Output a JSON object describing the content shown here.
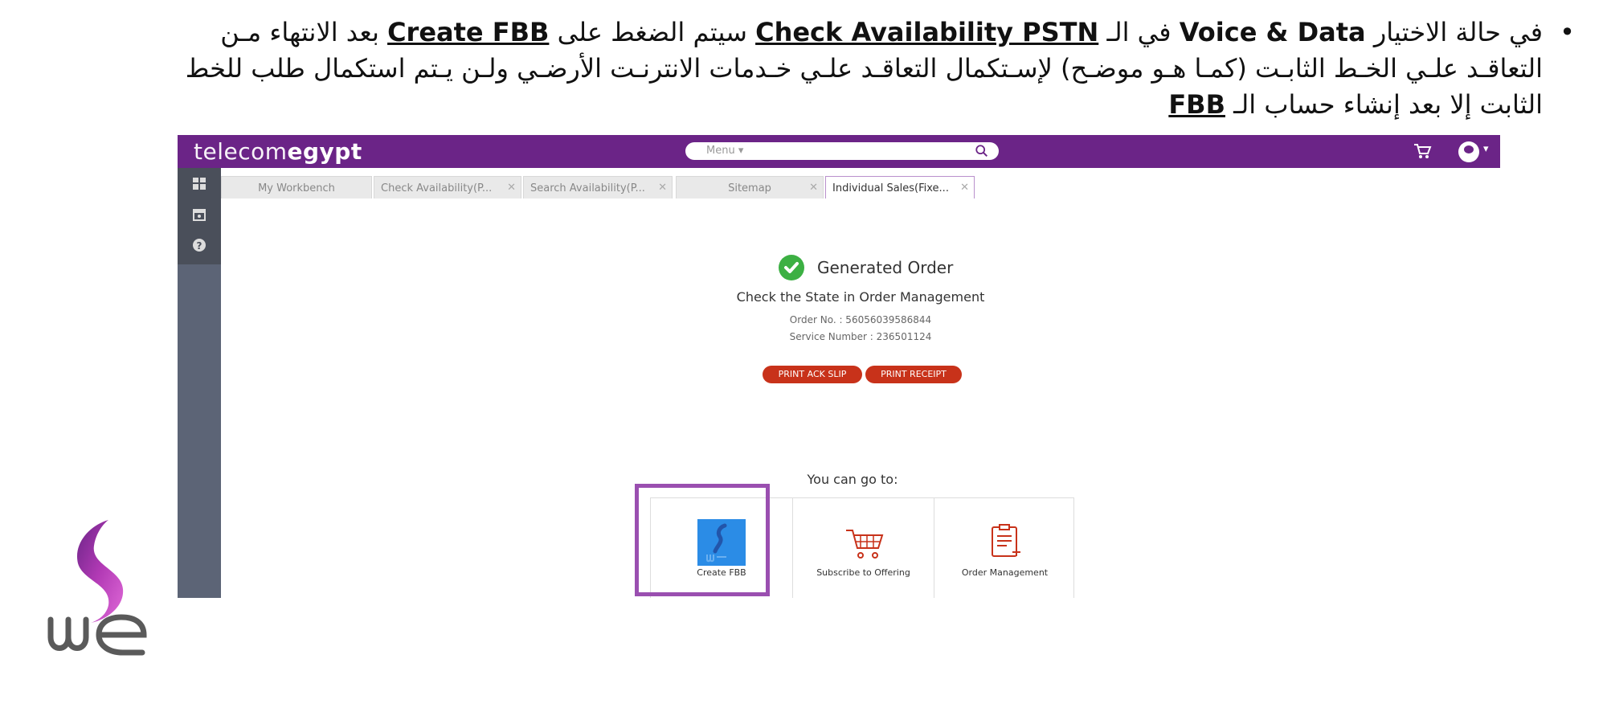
{
  "instruction": {
    "t1": "في حالة الاختيار ",
    "voice_data": "Voice & Data",
    "t2": " في الـ ",
    "check_avail": "Check Availability PSTN",
    "t3": " سيتم الضغط على ",
    "create_fbb": "Create FBB",
    "t4": " بعد الانتهاء مـن التعاقـد علـي الخـط الثابـت (كمـا هـو موضـح) لإسـتكمال التعاقـد علـي خـدمات الانترنـت الأرضـي ولـن يـتم استكمال طلب للخط الثابت إلا بعد إنشاء حساب الـ ",
    "fbb": "FBB"
  },
  "app": {
    "logo_light": "telecom",
    "logo_bold": "egypt",
    "menu_label": "Menu ▾",
    "avatar_caret": "▾"
  },
  "tabs": [
    {
      "label": "My Workbench"
    },
    {
      "label": "Check Availability(P..."
    },
    {
      "label": "Search Availability(P..."
    },
    {
      "label": "Sitemap"
    },
    {
      "label": "Individual Sales(Fixe..."
    }
  ],
  "tab_close": "✕",
  "order": {
    "title": "Generated Order",
    "subtitle": "Check the State in Order Management",
    "order_no": "Order No. : 56056039586844",
    "service_no": "Service Number : 236501124",
    "print_ack": "PRINT ACK SLIP",
    "print_receipt": "PRINT RECEIPT"
  },
  "goto": {
    "heading": "You can go to:",
    "items": [
      {
        "label": "Create FBB",
        "icon": "we-icon"
      },
      {
        "label": "Subscribe to Offering",
        "icon": "cart-icon"
      },
      {
        "label": "Order Management",
        "icon": "clipboard-icon"
      }
    ]
  },
  "brand": {
    "we_text": "we",
    "purple": "#6b2487",
    "red": "#c8321a",
    "green": "#3cb043"
  }
}
